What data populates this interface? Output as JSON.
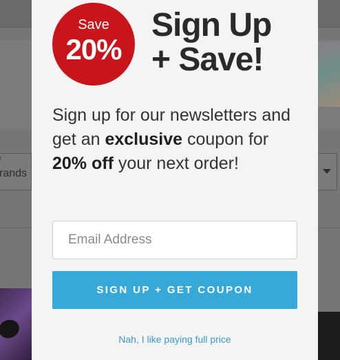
{
  "background": {
    "filter_small_label": "r",
    "filter_label": "rands"
  },
  "modal": {
    "badge": {
      "top_text": "Save",
      "amount": "20%"
    },
    "headline": {
      "line1": "Sign Up",
      "line2": "+ Save!"
    },
    "body": {
      "part1": "Sign up for our newsletters and get an ",
      "bold1": "exclusive",
      "part2": " coupon for ",
      "bold2": "20% off",
      "part3": " your next order!"
    },
    "email": {
      "placeholder": "Email Address",
      "value": ""
    },
    "signup_button_label": "SIGN UP + GET COUPON",
    "decline_label": "Nah, I like paying full price"
  },
  "colors": {
    "badge": "#c8151b",
    "button": "#36a9d8",
    "link": "#3a98cc",
    "overlay": "#767676"
  }
}
